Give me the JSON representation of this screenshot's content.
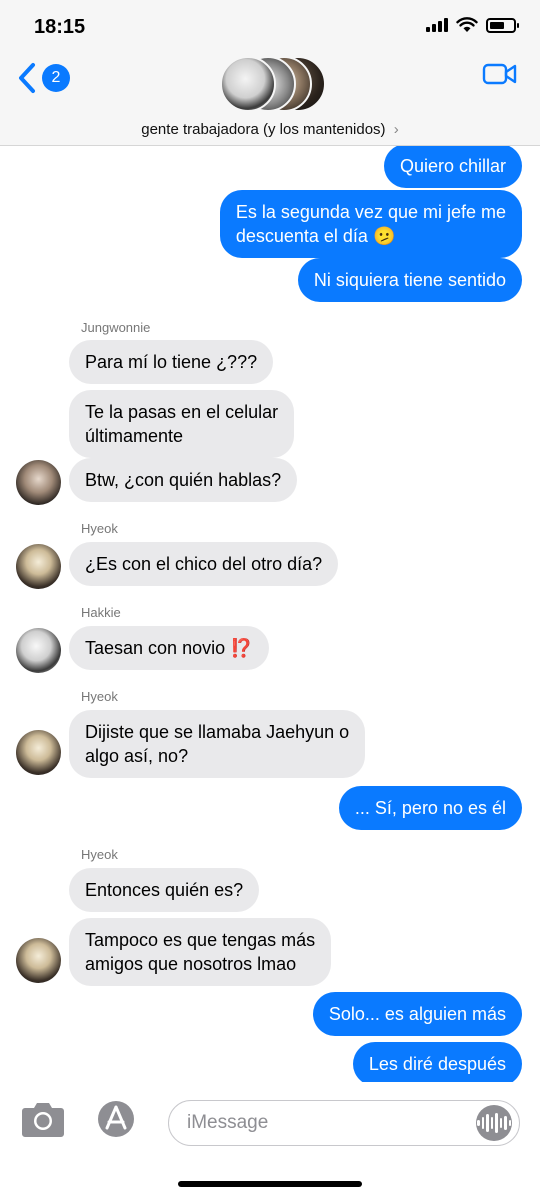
{
  "status_bar": {
    "time": "18:15"
  },
  "header": {
    "back_count": "2",
    "group_name": "gente trabajadora (y los mantenidos)",
    "chevron": "›"
  },
  "messages": [
    {
      "text": "Quiero chillar"
    },
    {
      "line1": "Es la segunda vez que mi jefe me",
      "line2": "descuenta el día 🫤"
    },
    {
      "text": "Ni siquiera tiene sentido"
    },
    {
      "sender": "Jungwonnie"
    },
    {
      "text": "Para mí lo tiene ¿???"
    },
    {
      "line1": "Te la pasas en el celular",
      "line2": "últimamente"
    },
    {
      "text": "Btw, ¿con quién hablas?"
    },
    {
      "sender": "Hyeok"
    },
    {
      "text": "¿Es con el chico del otro día?"
    },
    {
      "sender": "Hakkie"
    },
    {
      "text": "Taesan con novio ⁉️"
    },
    {
      "sender": "Hyeok"
    },
    {
      "line1": "Dijiste que se llamaba Jaehyun o",
      "line2": "algo así, no?"
    },
    {
      "text": "... Sí, pero no es él"
    },
    {
      "sender": "Hyeok"
    },
    {
      "text": "Entonces quién es?"
    },
    {
      "line1": "Tampoco es que tengas más",
      "line2": "amigos que nosotros lmao"
    },
    {
      "text": "Solo... es alguien más"
    },
    {
      "text": "Les diré después"
    }
  ],
  "input": {
    "placeholder": "iMessage"
  },
  "colors": {
    "accent": "#0a7aff",
    "incoming_bubble": "#e9e9eb",
    "header_bg": "#f6f6f6"
  },
  "icons": [
    "back-chevron-icon",
    "video-camera-icon",
    "camera-icon",
    "app-store-icon",
    "audio-waveform-icon",
    "signal-icon",
    "wifi-icon",
    "battery-icon"
  ]
}
